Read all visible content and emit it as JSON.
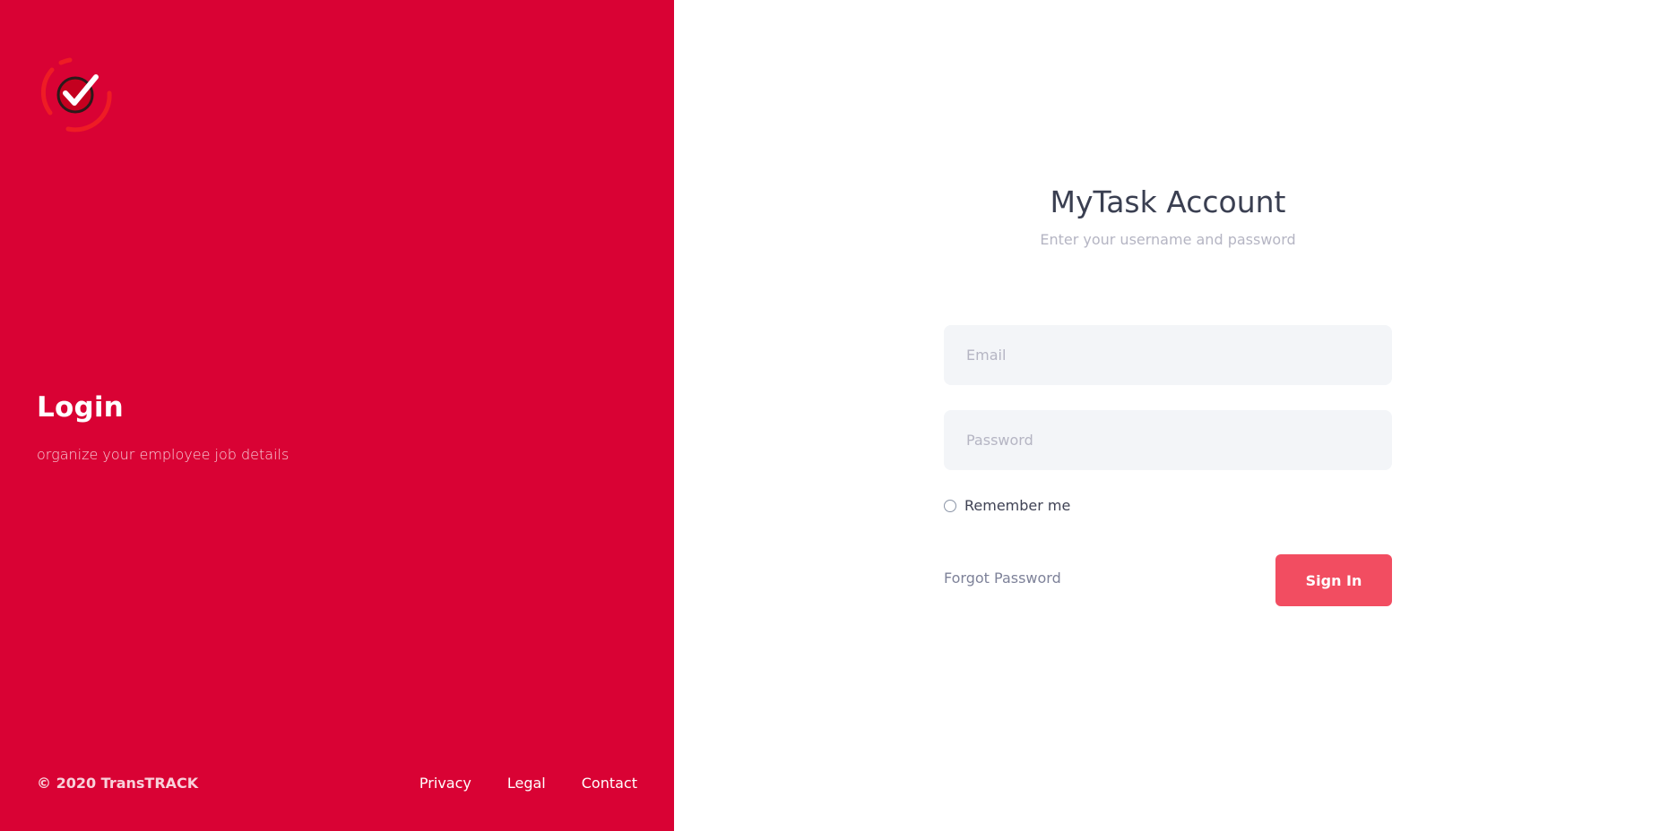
{
  "brand": {
    "logo_icon": "check-target-icon",
    "colors": {
      "primary": "#d90234",
      "accent_button": "#f24d61",
      "input_bg": "#f3f5f8"
    }
  },
  "left_panel": {
    "title": "Login",
    "subtitle": "organize your employee job details",
    "copyright": "© 2020 TransTRACK",
    "links": [
      "Privacy",
      "Legal",
      "Contact"
    ]
  },
  "form": {
    "title": "MyTask Account",
    "subtitle": "Enter your username and password",
    "email_placeholder": "Email",
    "email_value": "",
    "password_placeholder": "Password",
    "password_value": "",
    "remember_label": "Remember me",
    "remember_checked": false,
    "forgot_label": "Forgot Password",
    "signin_label": "Sign In"
  }
}
